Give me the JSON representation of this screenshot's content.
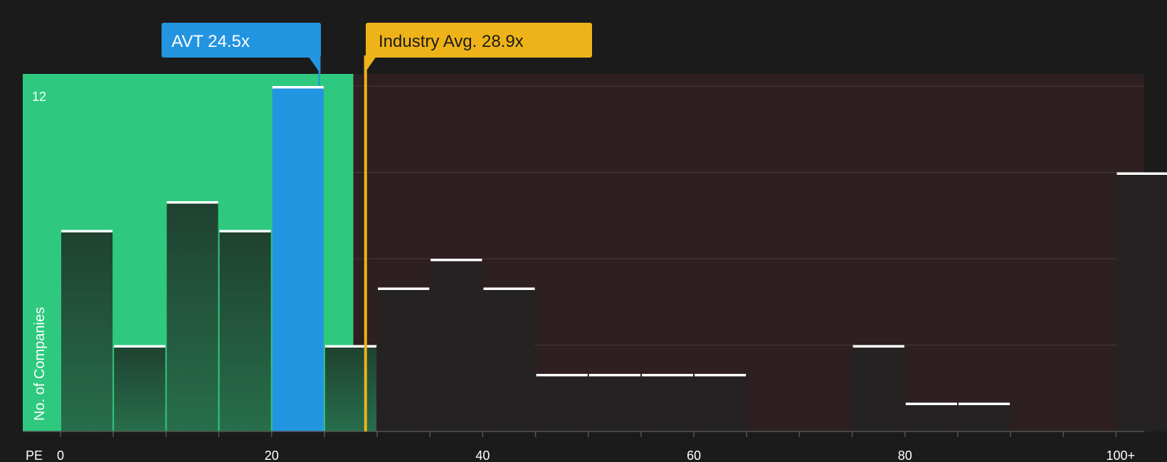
{
  "chart_data": {
    "type": "bar",
    "xlabel": "PE",
    "ylabel": "No. of Companies",
    "ymax_label": "12",
    "ylim": [
      0,
      12.5
    ],
    "xlim": [
      -5.3,
      103.2
    ],
    "x_ticks": [
      {
        "value": 0,
        "label": "0"
      },
      {
        "value": 20,
        "label": "20"
      },
      {
        "value": 40,
        "label": "40"
      },
      {
        "value": 60,
        "label": "60"
      },
      {
        "value": 80,
        "label": "80"
      },
      {
        "value": 100,
        "label": "100+"
      }
    ],
    "y_gridlines": [
      3,
      6,
      9,
      12
    ],
    "bins": [
      {
        "start": 0,
        "end": 5,
        "count": 7
      },
      {
        "start": 5,
        "end": 10,
        "count": 3
      },
      {
        "start": 10,
        "end": 15,
        "count": 8
      },
      {
        "start": 15,
        "end": 20,
        "count": 7
      },
      {
        "start": 20,
        "end": 25,
        "count": 12,
        "highlight": true
      },
      {
        "start": 25,
        "end": 30,
        "count": 3
      },
      {
        "start": 30,
        "end": 35,
        "count": 5
      },
      {
        "start": 35,
        "end": 40,
        "count": 6
      },
      {
        "start": 40,
        "end": 45,
        "count": 5
      },
      {
        "start": 45,
        "end": 50,
        "count": 2
      },
      {
        "start": 50,
        "end": 55,
        "count": 2
      },
      {
        "start": 55,
        "end": 60,
        "count": 2
      },
      {
        "start": 60,
        "end": 65,
        "count": 2
      },
      {
        "start": 75,
        "end": 80,
        "count": 3
      },
      {
        "start": 80,
        "end": 85,
        "count": 1
      },
      {
        "start": 85,
        "end": 90,
        "count": 1
      },
      {
        "start": 100,
        "end": 105,
        "count": 9
      }
    ],
    "company": {
      "label": "AVT 24.5x",
      "value": 24.5
    },
    "industry": {
      "label": "Industry Avg. 28.9x",
      "value": 28.9
    },
    "fair_zone_end": 27.75,
    "colors": {
      "background": "#1b1b1b",
      "fair_zone": "#2ec97e",
      "overvalued_zone": "#2e1f20",
      "bar_in_zone_top": "#1f4130",
      "bar_in_zone_bottom": "#276e4c",
      "bar_out_zone": "#242222",
      "highlight_bar": "#2394e0",
      "company_callout": "#2394e0",
      "industry_callout": "#eeb318",
      "industry_text": "#1b1b1b",
      "cap": "#ffffff",
      "axis": "#555555",
      "grid": "#4a3a3b"
    }
  }
}
